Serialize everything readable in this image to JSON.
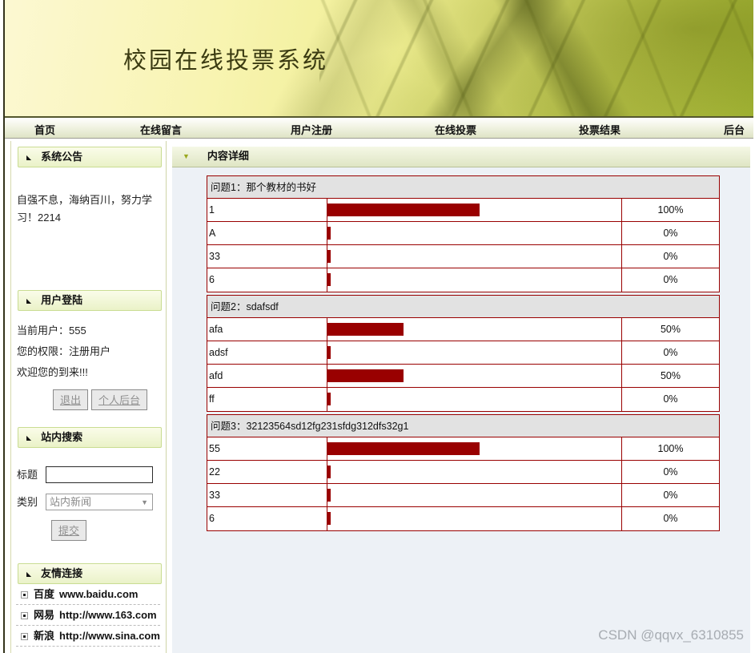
{
  "banner": {
    "title": "校园在线投票系统"
  },
  "nav": {
    "items": [
      {
        "label": "首页"
      },
      {
        "label": "在线留言"
      },
      {
        "label": "用户注册"
      },
      {
        "label": "在线投票"
      },
      {
        "label": "投票结果"
      },
      {
        "label": "后台"
      }
    ]
  },
  "sidebar": {
    "announcement": {
      "title": "系统公告",
      "text": "自强不息，海纳百川，努力学习！2214"
    },
    "login": {
      "title": "用户登陆",
      "current_user": "当前用户：555",
      "permission": "您的权限：注册用户",
      "welcome": "欢迎您的到来!!!",
      "logout_button": "退出",
      "personal_admin_button": "个人后台"
    },
    "search": {
      "title": "站内搜索",
      "keyword_label": "标题",
      "keyword_value": "",
      "category_label": "类别",
      "category_selected": "站内新闻",
      "submit_button": "提交"
    },
    "links": {
      "title": "友情连接",
      "items": [
        {
          "name": "百度",
          "url": "www.baidu.com"
        },
        {
          "name": "网易",
          "url": "http://www.163.com"
        },
        {
          "name": "新浪",
          "url": "http://www.sina.com"
        }
      ]
    }
  },
  "main": {
    "header": "内容详细",
    "bar_color": "#990000",
    "polls": [
      {
        "question": "问题1：那个教材的书好",
        "options": [
          {
            "label": "1",
            "percent": 100,
            "percent_label": "100%"
          },
          {
            "label": "A",
            "percent": 0,
            "percent_label": "0%"
          },
          {
            "label": "33",
            "percent": 0,
            "percent_label": "0%"
          },
          {
            "label": "6",
            "percent": 0,
            "percent_label": "0%"
          }
        ]
      },
      {
        "question": "问题2：sdafsdf",
        "options": [
          {
            "label": "afa",
            "percent": 50,
            "percent_label": "50%"
          },
          {
            "label": "adsf",
            "percent": 0,
            "percent_label": "0%"
          },
          {
            "label": "afd",
            "percent": 50,
            "percent_label": "50%"
          },
          {
            "label": "ff",
            "percent": 0,
            "percent_label": "0%"
          }
        ]
      },
      {
        "question": "问题3：32123564sd12fg231sfdg312dfs32g1",
        "options": [
          {
            "label": "55",
            "percent": 100,
            "percent_label": "100%"
          },
          {
            "label": "22",
            "percent": 0,
            "percent_label": "0%"
          },
          {
            "label": "33",
            "percent": 0,
            "percent_label": "0%"
          },
          {
            "label": "6",
            "percent": 0,
            "percent_label": "0%"
          }
        ]
      }
    ]
  },
  "watermark": "CSDN @qqvx_6310855"
}
